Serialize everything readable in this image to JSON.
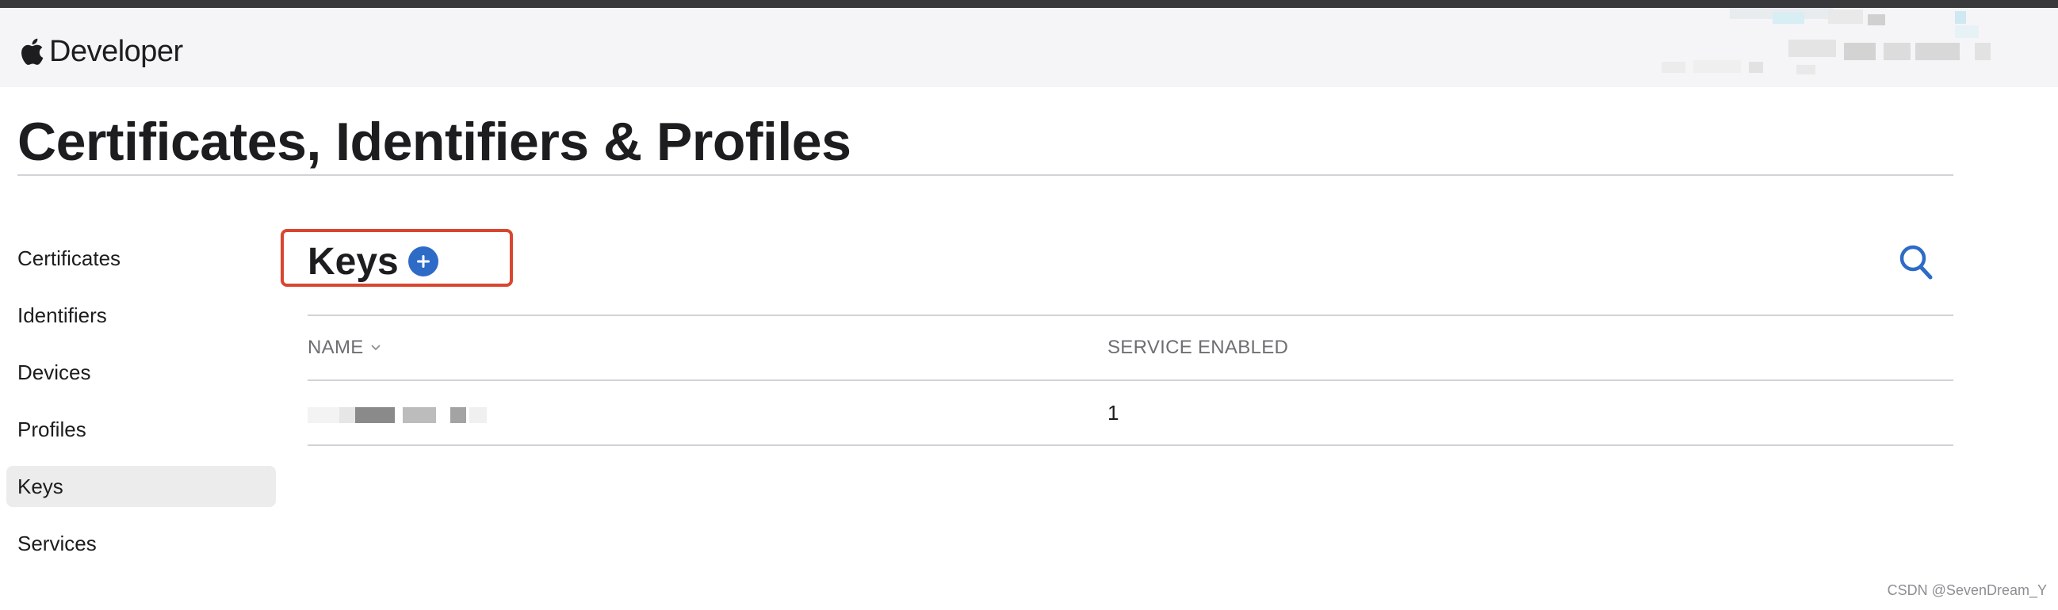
{
  "header": {
    "brand_text": "Developer",
    "logo_icon": "apple-logo-icon"
  },
  "page": {
    "title": "Certificates, Identifiers & Profiles"
  },
  "sidebar": {
    "items": [
      {
        "label": "Certificates",
        "active": false
      },
      {
        "label": "Identifiers",
        "active": false
      },
      {
        "label": "Devices",
        "active": false
      },
      {
        "label": "Profiles",
        "active": false
      },
      {
        "label": "Keys",
        "active": true
      },
      {
        "label": "Services",
        "active": false
      }
    ]
  },
  "section": {
    "title": "Keys",
    "add_icon": "plus-circle-icon",
    "search_icon": "search-icon"
  },
  "table": {
    "columns": [
      "NAME",
      "SERVICE ENABLED"
    ],
    "sort_icon": "chevron-down-icon",
    "rows": [
      {
        "name": "",
        "service_enabled": "1"
      }
    ]
  },
  "watermark": "CSDN @SevenDream_Y",
  "colors": {
    "accent": "#2d6bc7",
    "highlight_frame": "#d9462f",
    "active_item_bg": "#ececec"
  }
}
